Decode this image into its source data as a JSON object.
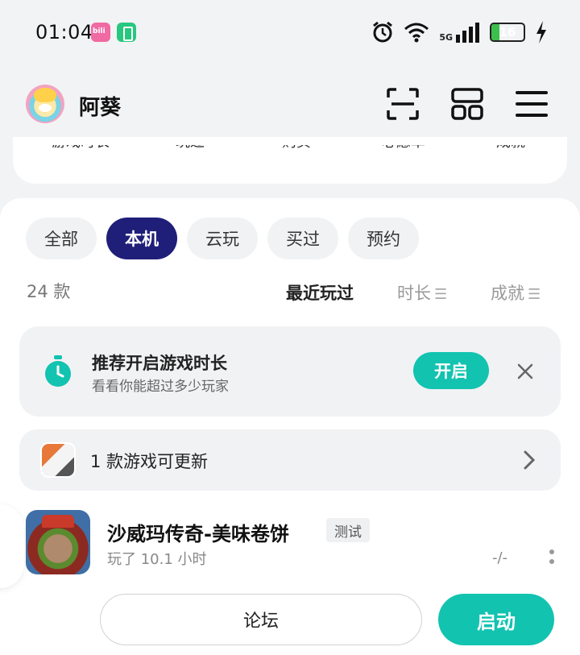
{
  "status_bar": {
    "time": "01:04",
    "network": "5G",
    "battery_level": "16",
    "battery_fraction": 0.16,
    "icons": [
      "bilibili-app-icon",
      "battery-app-icon",
      "alarm-icon",
      "wifi-icon",
      "signal-icon",
      "battery-icon",
      "charging-icon"
    ]
  },
  "header": {
    "username": "阿葵",
    "icons": [
      "scan-icon",
      "grid-icon",
      "menu-icon"
    ]
  },
  "stats": [
    "游戏时长",
    "玩过",
    "购买",
    "心愿单",
    "成就"
  ],
  "tabs": [
    {
      "label": "全部",
      "active": false
    },
    {
      "label": "本机",
      "active": true
    },
    {
      "label": "云玩",
      "active": false
    },
    {
      "label": "买过",
      "active": false
    },
    {
      "label": "预约",
      "active": false
    }
  ],
  "list": {
    "count": "24 款",
    "sort_options": [
      {
        "label": "最近玩过",
        "active": true
      },
      {
        "label": "时长",
        "active": false
      },
      {
        "label": "成就",
        "active": false
      }
    ]
  },
  "recommend": {
    "title": "推荐开启游戏时长",
    "subtitle": "看看你能超过多少玩家",
    "button": "开启"
  },
  "update": {
    "text": "1 款游戏可更新"
  },
  "game": {
    "title": "沙威玛传奇-美味卷饼",
    "tag": "测试",
    "playtime": "玩了 10.1 小时",
    "value": "-/-"
  },
  "actions": {
    "forum": "论坛",
    "start": "启动"
  },
  "colors": {
    "accent": "#12c3b0",
    "active_tab": "#1f1f7a"
  }
}
